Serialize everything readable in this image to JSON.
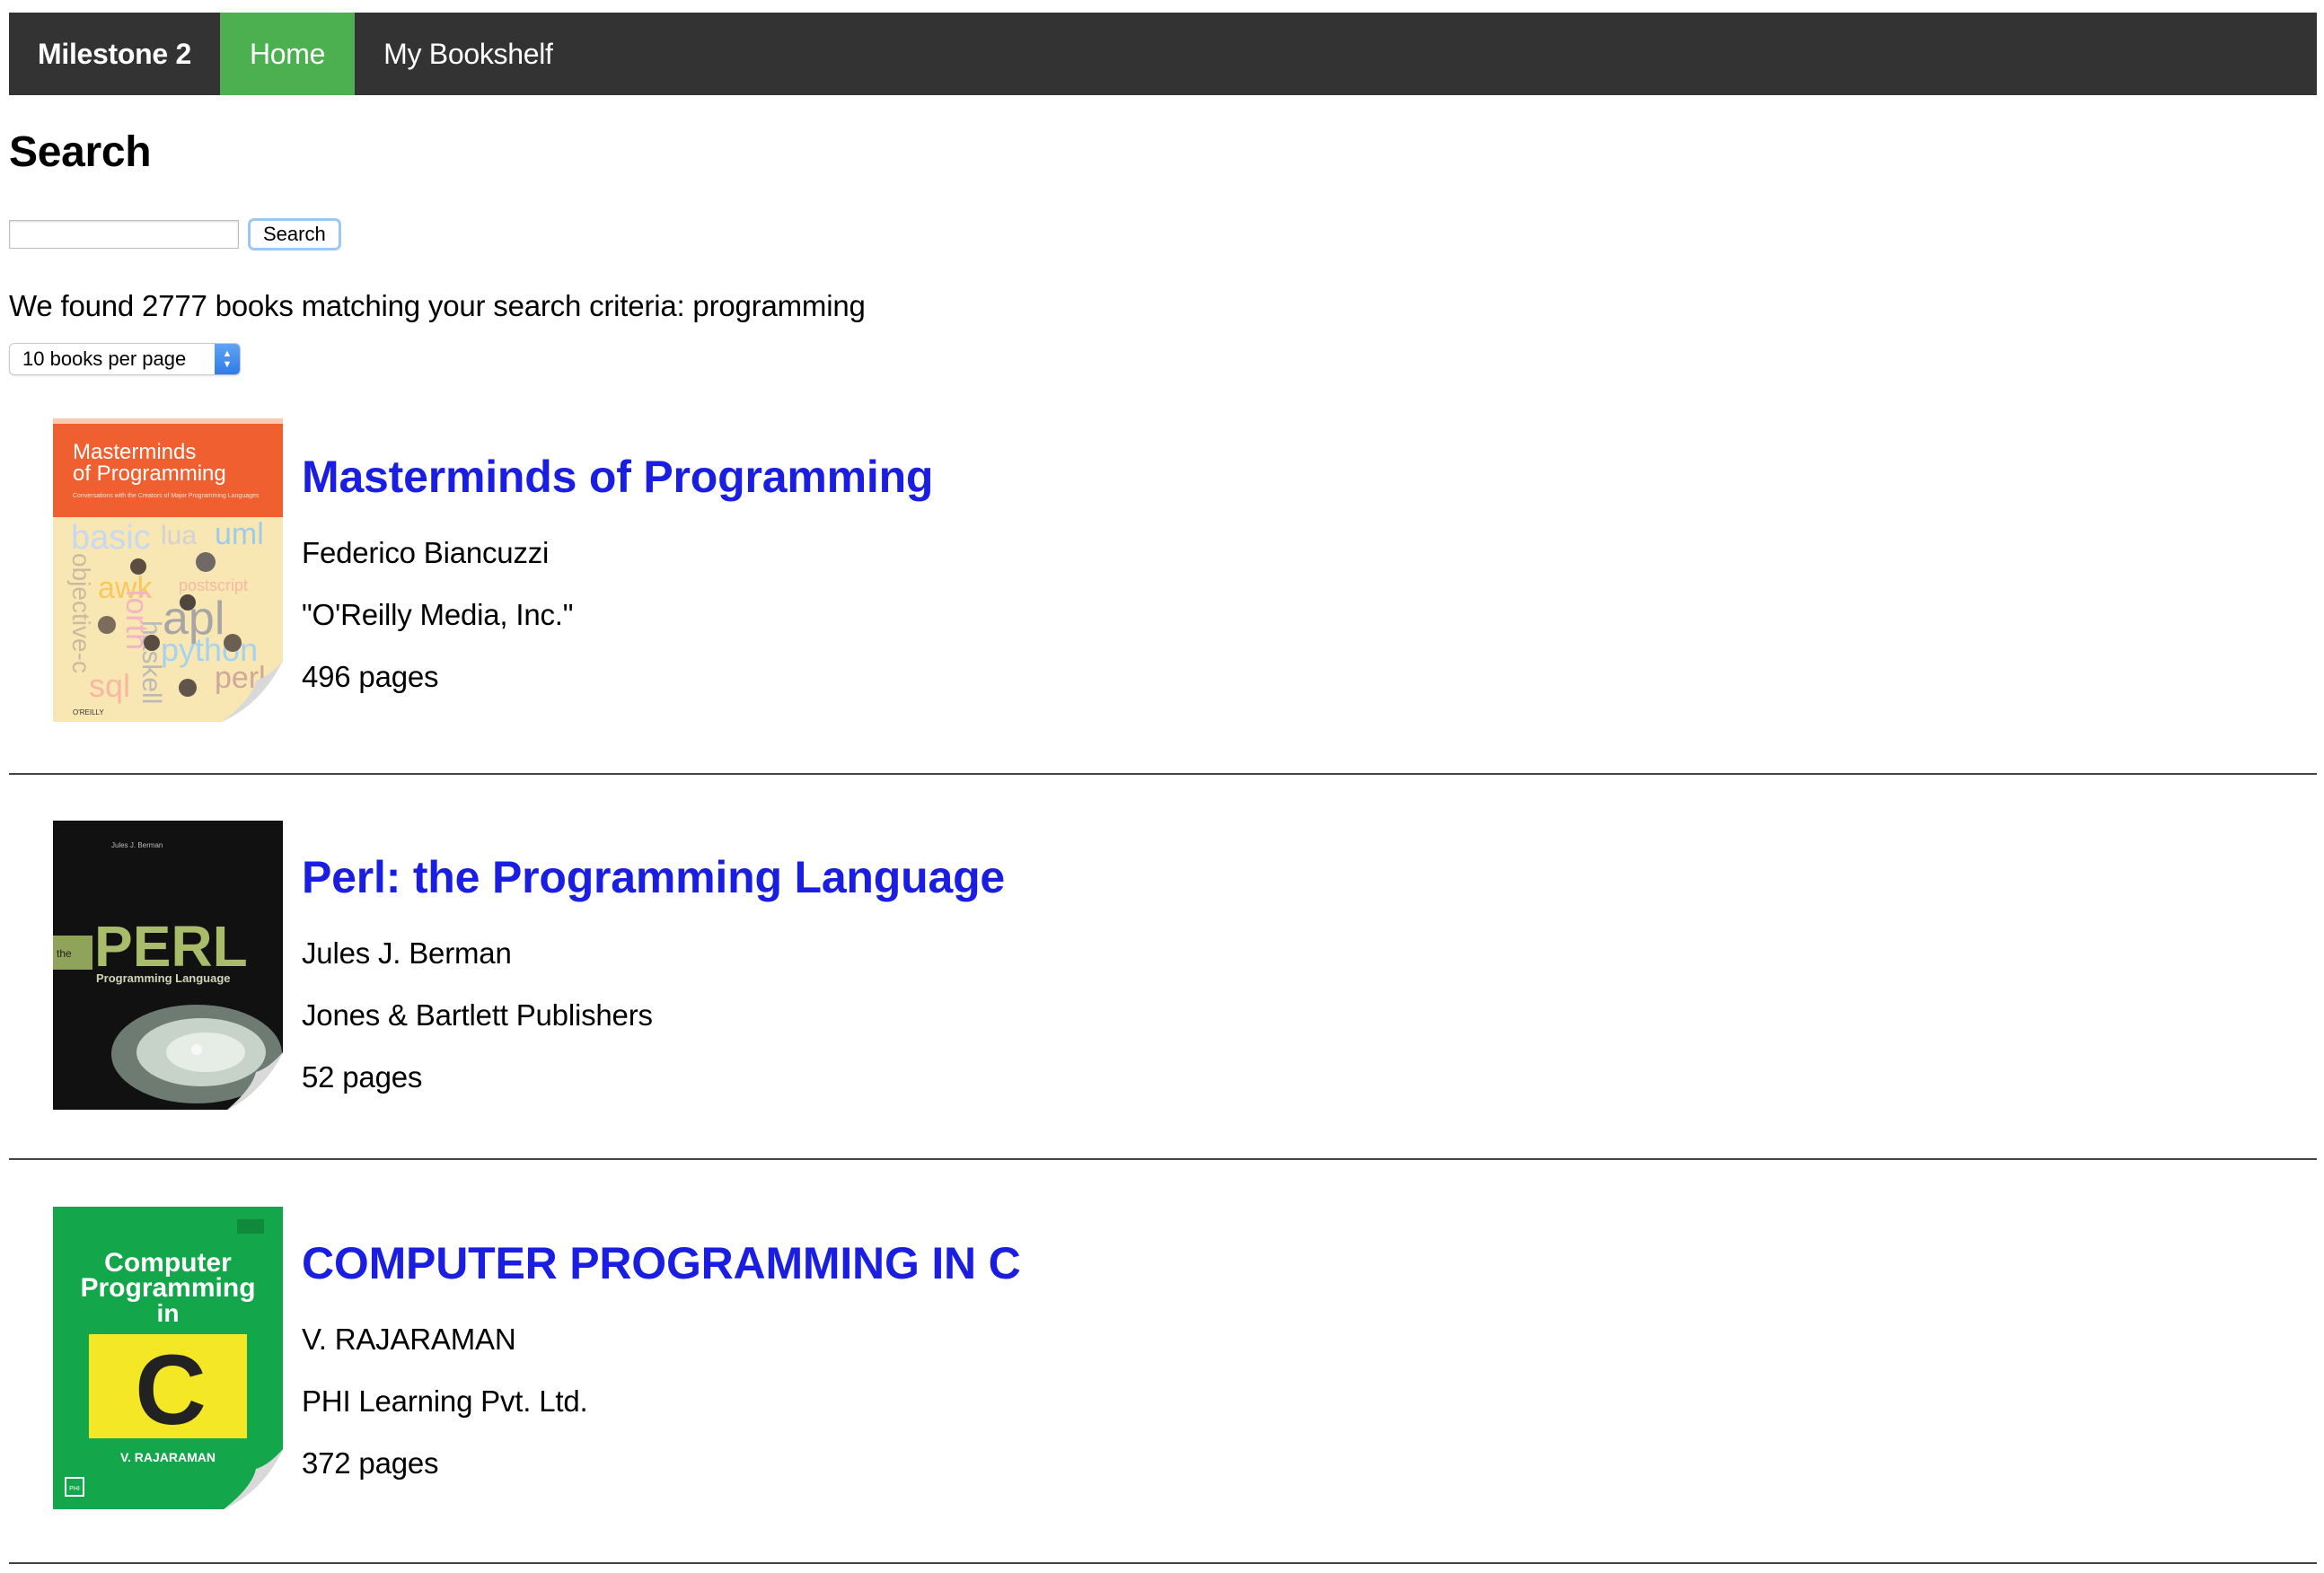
{
  "navbar": {
    "brand": "Milestone 2",
    "items": [
      {
        "label": "Home",
        "active": true
      },
      {
        "label": "My Bookshelf",
        "active": false
      }
    ],
    "colors": {
      "background": "#333333",
      "active": "#4caf50"
    }
  },
  "page_title": "Search",
  "search": {
    "value": "",
    "placeholder": "",
    "button_label": "Search"
  },
  "result_text": "We found 2777 books matching your search criteria: programming",
  "per_page": {
    "selected": "10 books per page"
  },
  "books": [
    {
      "title": "Masterminds of Programming",
      "author": "Federico Biancuzzi",
      "publisher": "\"O'Reilly Media, Inc.\"",
      "pages": "496 pages",
      "cover": {
        "line1": "Masterminds",
        "line2": "of Programming",
        "subtitle": "Conversations with the Creators of Major Programming Languages",
        "words": [
          "basic",
          "lua",
          "uml",
          "objective-c",
          "awk",
          "forth",
          "apl",
          "postscript",
          "python",
          "haskell",
          "sql",
          "perl"
        ],
        "publisher": "O'REILLY"
      }
    },
    {
      "title": "Perl: the Programming Language",
      "author": "Jules J. Berman",
      "publisher": "Jones & Bartlett Publishers",
      "pages": "52 pages",
      "cover": {
        "author": "Jules J. Berman",
        "prefix": "the",
        "big": "PERL",
        "sub": "Programming Language"
      }
    },
    {
      "title": "COMPUTER PROGRAMMING IN C",
      "author": "V. RAJARAMAN",
      "publisher": "PHI Learning Pvt. Ltd.",
      "pages": "372 pages",
      "cover": {
        "line1": "Computer",
        "line2": "Programming",
        "line3": "in",
        "letter": "C",
        "author": "V. RAJARAMAN",
        "logo": "PHI"
      }
    }
  ],
  "colors": {
    "link": "#1a1ee0",
    "cover1_top": "#ef5f30",
    "cover1_bottom": "#f9e7b3",
    "cover2_bg": "#111111",
    "cover3_bg": "#14a64a",
    "cover3_box": "#f4e826"
  }
}
